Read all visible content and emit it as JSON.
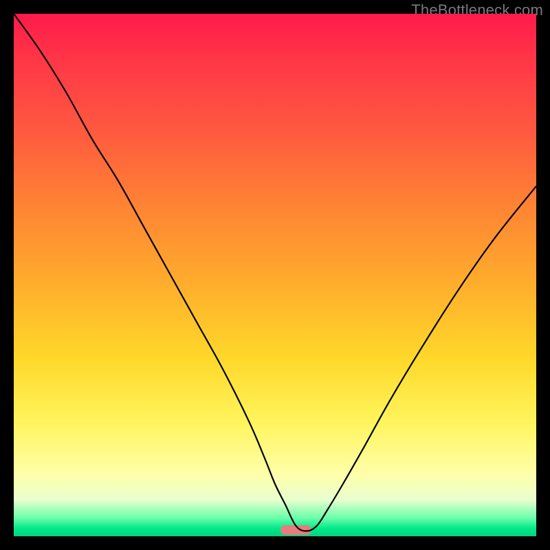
{
  "watermark": "TheBottleneck.com",
  "colors": {
    "frame": "#000000",
    "gradient_top": "#ff1a4b",
    "gradient_bottom": "#00d480",
    "optimal_marker": "#e87b7d",
    "curve": "#000000"
  },
  "chart_data": {
    "type": "line",
    "title": "",
    "xlabel": "",
    "ylabel": "",
    "xlim": [
      0,
      100
    ],
    "ylim": [
      0,
      100
    ],
    "optimal_x": 54,
    "optimal_marker_width_pct": 6,
    "series": [
      {
        "name": "bottleneck-curve",
        "x": [
          0,
          5,
          10,
          15,
          20,
          25,
          30,
          35,
          40,
          45,
          48,
          50,
          52,
          54,
          56,
          58,
          60,
          63,
          67,
          72,
          78,
          85,
          92,
          100
        ],
        "values": [
          100,
          93,
          85,
          76,
          68,
          59,
          50,
          41,
          32,
          22,
          15,
          10,
          6,
          2,
          1,
          2,
          5,
          10,
          17,
          26,
          36,
          47,
          57,
          67
        ]
      }
    ]
  }
}
